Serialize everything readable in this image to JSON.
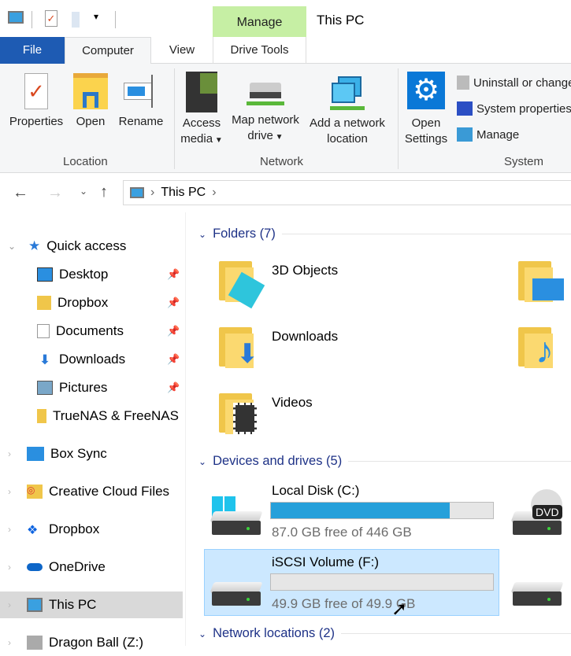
{
  "window": {
    "title": "This PC",
    "context_tab": "Manage"
  },
  "tabs": [
    "File",
    "Computer",
    "View",
    "Drive Tools"
  ],
  "ribbon": {
    "location": {
      "label": "Location",
      "buttons": [
        "Properties",
        "Open",
        "Rename"
      ]
    },
    "network": {
      "label": "Network",
      "access_media": [
        "Access",
        "media"
      ],
      "map_drive": [
        "Map network",
        "drive"
      ],
      "add_location": [
        "Add a network",
        "location"
      ]
    },
    "system": {
      "label": "System",
      "open_settings": [
        "Open",
        "Settings"
      ],
      "items": [
        "Uninstall or change",
        "System properties",
        "Manage"
      ]
    }
  },
  "address": {
    "path": "This PC"
  },
  "nav": {
    "quick_access": "Quick access",
    "pinned": [
      "Desktop",
      "Dropbox",
      "Documents",
      "Downloads",
      "Pictures"
    ],
    "truenas": "TrueNAS & FreeNAS",
    "roots": [
      "Box Sync",
      "Creative Cloud Files",
      "Dropbox",
      "OneDrive",
      "This PC",
      "Dragon Ball (Z:)"
    ]
  },
  "content": {
    "folders_header": "Folders (7)",
    "folders": [
      "3D Objects",
      "Downloads",
      "Videos"
    ],
    "devices_header": "Devices and drives (5)",
    "drives": [
      {
        "name": "Local Disk (C:)",
        "free": "87.0 GB free of 446 GB",
        "used_pct": 80.5
      },
      {
        "name": "iSCSI Volume (F:)",
        "free": "49.9 GB free of 49.9 GB",
        "used_pct": 0
      }
    ],
    "dvd_label": "DVD",
    "network_header": "Network locations (2)"
  },
  "colors": {
    "file_tab": "#1e5bb3",
    "manage_tab": "#c6efa4",
    "bar_fill": "#26a0da",
    "selection": "#cce8ff",
    "section": "#1e3287"
  }
}
